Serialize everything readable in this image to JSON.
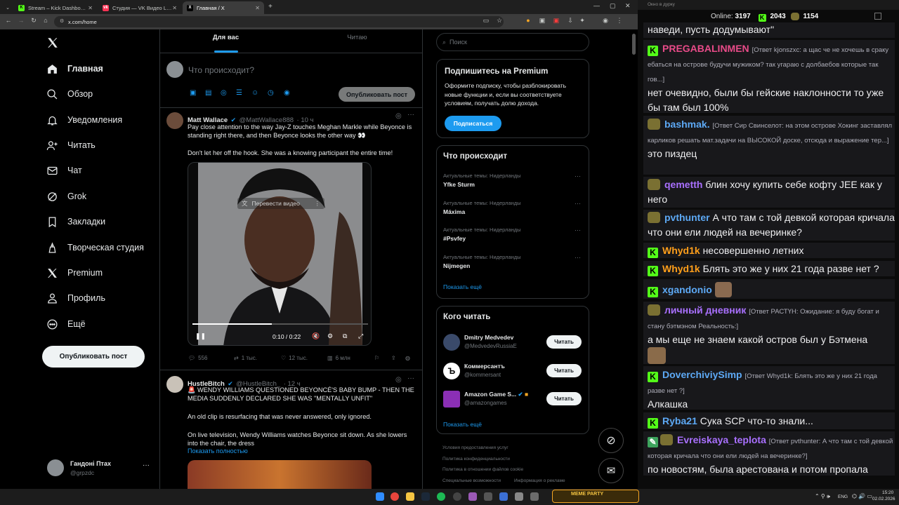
{
  "browser": {
    "tabs": [
      {
        "title": "Stream – Kick Dashboard",
        "favicon": "K",
        "color": "#53fc18"
      },
      {
        "title": "Студия — VK Видео Live",
        "favicon": "vk",
        "color": "#ff3355"
      },
      {
        "title": "Главная / X",
        "favicon": "X",
        "color": "#ffffff"
      }
    ],
    "url": "x.com/home"
  },
  "sidebar": {
    "items": [
      {
        "label": "Главная",
        "icon": "home-icon"
      },
      {
        "label": "Обзор",
        "icon": "search-icon"
      },
      {
        "label": "Уведомления",
        "icon": "bell-icon"
      },
      {
        "label": "Читать",
        "icon": "follow-icon"
      },
      {
        "label": "Чат",
        "icon": "mail-icon"
      },
      {
        "label": "Grok",
        "icon": "grok-icon"
      },
      {
        "label": "Закладки",
        "icon": "bookmark-icon"
      },
      {
        "label": "Творческая студия",
        "icon": "studio-icon"
      },
      {
        "label": "Premium",
        "icon": "x-logo-icon"
      },
      {
        "label": "Профиль",
        "icon": "person-icon"
      },
      {
        "label": "Ещё",
        "icon": "more-icon"
      }
    ],
    "post_button": "Опубликовать пост",
    "account": {
      "name": "Гандоні Птах",
      "handle": "@grpzdc"
    }
  },
  "feed": {
    "tabs": [
      "Для вас",
      "Читаю"
    ],
    "composer": {
      "placeholder": "Что происходит?",
      "button": "Опубликовать пост"
    },
    "tweets": [
      {
        "name": "Matt Wallace",
        "handle": "@MattWallace888",
        "time": "· 10 ч",
        "text1": "Pay close attention to the way Jay-Z touches Meghan Markle while Beyonce is standing right there, and then Beyonce looks the other way 👀",
        "text2": "Don't let her off the hook. She was a knowing participant the entire time!",
        "video": {
          "translate": "Перевести видео",
          "time": "0:10 / 0:22",
          "progress": 0.45
        },
        "stats": {
          "replies": "556",
          "reposts": "1 тыс.",
          "likes": "12 тыс.",
          "views": "6 млн"
        }
      },
      {
        "name": "HustleBitch",
        "handle": "@HustleBitch_",
        "time": "· 12 ч",
        "text1": "🚨 WENDY WILLIAMS QUESTIONED BEYONCÉ'S BABY BUMP - THEN THE MEDIA SUDDENLY DECLARED SHE WAS \"MENTALLY UNFIT\"",
        "text2": "An old clip is resurfacing that was never answered, only ignored.",
        "text3": "On live television, Wendy Williams watches Beyonce sit down. As she lowers into the chair, the dress",
        "show_more": "Показать полностью"
      }
    ]
  },
  "right": {
    "search_placeholder": "Поиск",
    "premium": {
      "title": "Подпишитесь на Premium",
      "text": "Оформите подписку, чтобы разблокировать новые функции и, если вы соответствуете условиям, получать долю дохода.",
      "button": "Подписаться"
    },
    "trends": {
      "title": "Что происходит",
      "items": [
        {
          "sub": "Актуальные темы: Нидерланды",
          "name": "Yfke Sturm"
        },
        {
          "sub": "Актуальные темы: Нидерланды",
          "name": "Máxima"
        },
        {
          "sub": "Актуальные темы: Нидерланды",
          "name": "#Psvfey"
        },
        {
          "sub": "Актуальные темы: Нидерланды",
          "name": "Nijmegen"
        }
      ],
      "more": "Показать ещё"
    },
    "who": {
      "title": "Кого читать",
      "items": [
        {
          "name": "Dmitry Medvedev",
          "handle": "@MedvedevRussiaE",
          "btn": "Читать"
        },
        {
          "name": "Коммерсантъ",
          "handle": "@kommersant",
          "btn": "Читать"
        },
        {
          "name": "Amazon Game S...",
          "handle": "@amazongames",
          "btn": "Читать"
        }
      ],
      "more": "Показать ещё"
    },
    "footer": [
      "Условия предоставления услуг",
      "Политика конфиденциальности",
      "Политика в отношении файлов cookie",
      "Специальные возможности",
      "Информация о рекламе"
    ]
  },
  "chat": {
    "window_title": "Окно в дурку",
    "online_label": "Online:",
    "online": "3197",
    "kick_count": "2043",
    "vk_count": "1154",
    "messages": [
      {
        "text": "наведи, пусть додумывают\""
      },
      {
        "user": "PREGABALINMEN",
        "color": "#e94b89",
        "reply": "[Ответ kjonszxc: а щас че не хочешь в сраку ебаться на острове будучи мужиком? так угараю с долбаебов которые так гов...]",
        "text": "нет очевидно, были бы гейские наклонности то уже бы там был 100%"
      },
      {
        "user": "bashmak.",
        "color": "#5da9f5",
        "reply": "[Ответ Сир Свинселот: на этом острове Хокинг заставлял карликов решать мат.задачи на ВЫСОКОЙ доске, отсюда и выражение тер...]",
        "text": "это пиздец"
      },
      {
        "user": "qemetth",
        "color": "#a970ff",
        "text": "блин хочу купить себе кофту JEE как у него"
      },
      {
        "user": "pvthunter",
        "color": "#5da9f5",
        "text": "А что там с той девкой которая кричала что они ели людей на вечеринке?"
      },
      {
        "user": "Whyd1k",
        "color": "#ff9f1a",
        "text": "несовершенно летних"
      },
      {
        "user": "Whyd1k",
        "color": "#ff9f1a",
        "text": "Блять это же у них 21 года разве нет ?"
      },
      {
        "user": "xgandonio",
        "color": "#5da9f5",
        "text": ""
      },
      {
        "user": "личный дневник",
        "color": "#a970ff",
        "reply": "[Ответ РАСТҮН: Ожидание: я буду богат и стану бэтмэном Реальность:]",
        "text": "а мы еще не знаем какой остров был у Бэтмена"
      },
      {
        "user": "DoverchiviySimp",
        "color": "#5da9f5",
        "reply": "[Ответ Whyd1k: Блять это же у них 21 года разве нет ?]",
        "text": "Алкашка"
      },
      {
        "user": "Ryba21",
        "color": "#5da9f5",
        "text": "Сука SCP что-то знали..."
      },
      {
        "user": "Evreiskaya_teplota",
        "color": "#a970ff",
        "reply": "[Ответ pvthunter: А что там с той девкой которая кричала что они ели людей на вечеринке?]",
        "text": "по новостям, была арестована и потом пропала"
      }
    ]
  },
  "taskbar": {
    "lang": "ENG",
    "time": "15:20",
    "date": "02.02.2026",
    "meme_party": "MEME PARTY"
  }
}
